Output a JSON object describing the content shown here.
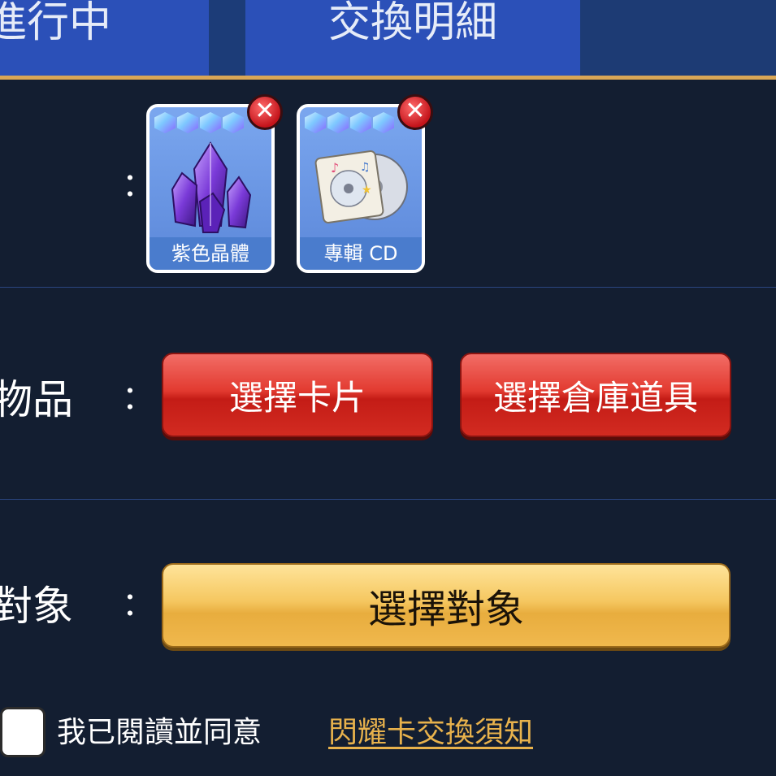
{
  "tabs": {
    "in_progress": "進行中",
    "exchange_detail": "交換明細"
  },
  "rows": {
    "items_colon": "：",
    "exchange_items_label": "物品",
    "exchange_items_colon": "：",
    "target_label": "對象",
    "target_colon": "："
  },
  "selected_items": [
    {
      "name": "紫色晶體",
      "icon": "purple-crystal-icon",
      "stars": 4
    },
    {
      "name": "專輯 CD",
      "icon": "album-cd-icon",
      "stars": 4
    }
  ],
  "buttons": {
    "select_card": "選擇卡片",
    "select_warehouse_item": "選擇倉庫道具",
    "select_target": "選擇對象"
  },
  "agreement": {
    "text": "我已閱讀並同意",
    "link": "閃耀卡交換須知",
    "checked": false
  },
  "colors": {
    "background": "#131e31",
    "tab": "#2b50b8",
    "accent_gold": "#d9a656",
    "red_button": "#e23a30",
    "gold_button": "#f5c760",
    "link": "#e8b24c"
  }
}
